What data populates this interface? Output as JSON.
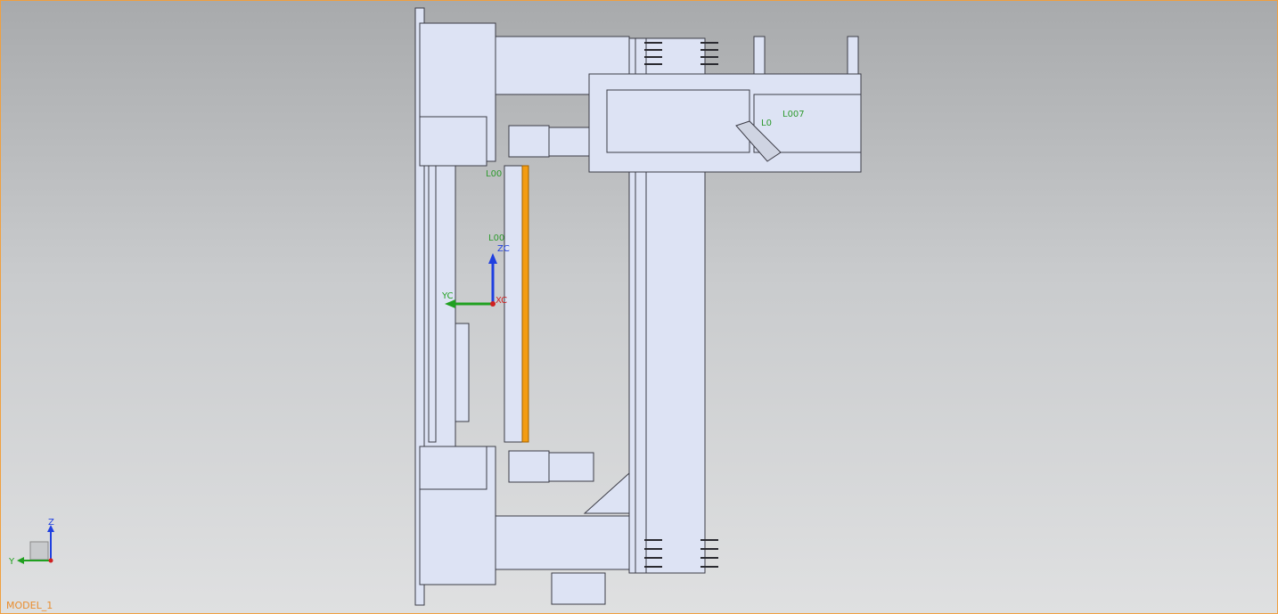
{
  "viewport": {
    "model_name": "MODEL_1",
    "border_color": "#f0a040",
    "part_fill": "#dde3f4",
    "edge_color": "#3c3c46",
    "highlight_color": "#f39c12"
  },
  "part_labels": {
    "l_top": "L00",
    "l_mid": "L00",
    "l_007": "L007",
    "l_right": "L0"
  },
  "wcs": {
    "zc": "ZC",
    "yc": "YC",
    "xc": "XC"
  },
  "triad": {
    "z": "Z",
    "y": "Y"
  },
  "icons": {
    "wcs": "wcs-axis-icon",
    "triad": "view-triad-icon"
  }
}
